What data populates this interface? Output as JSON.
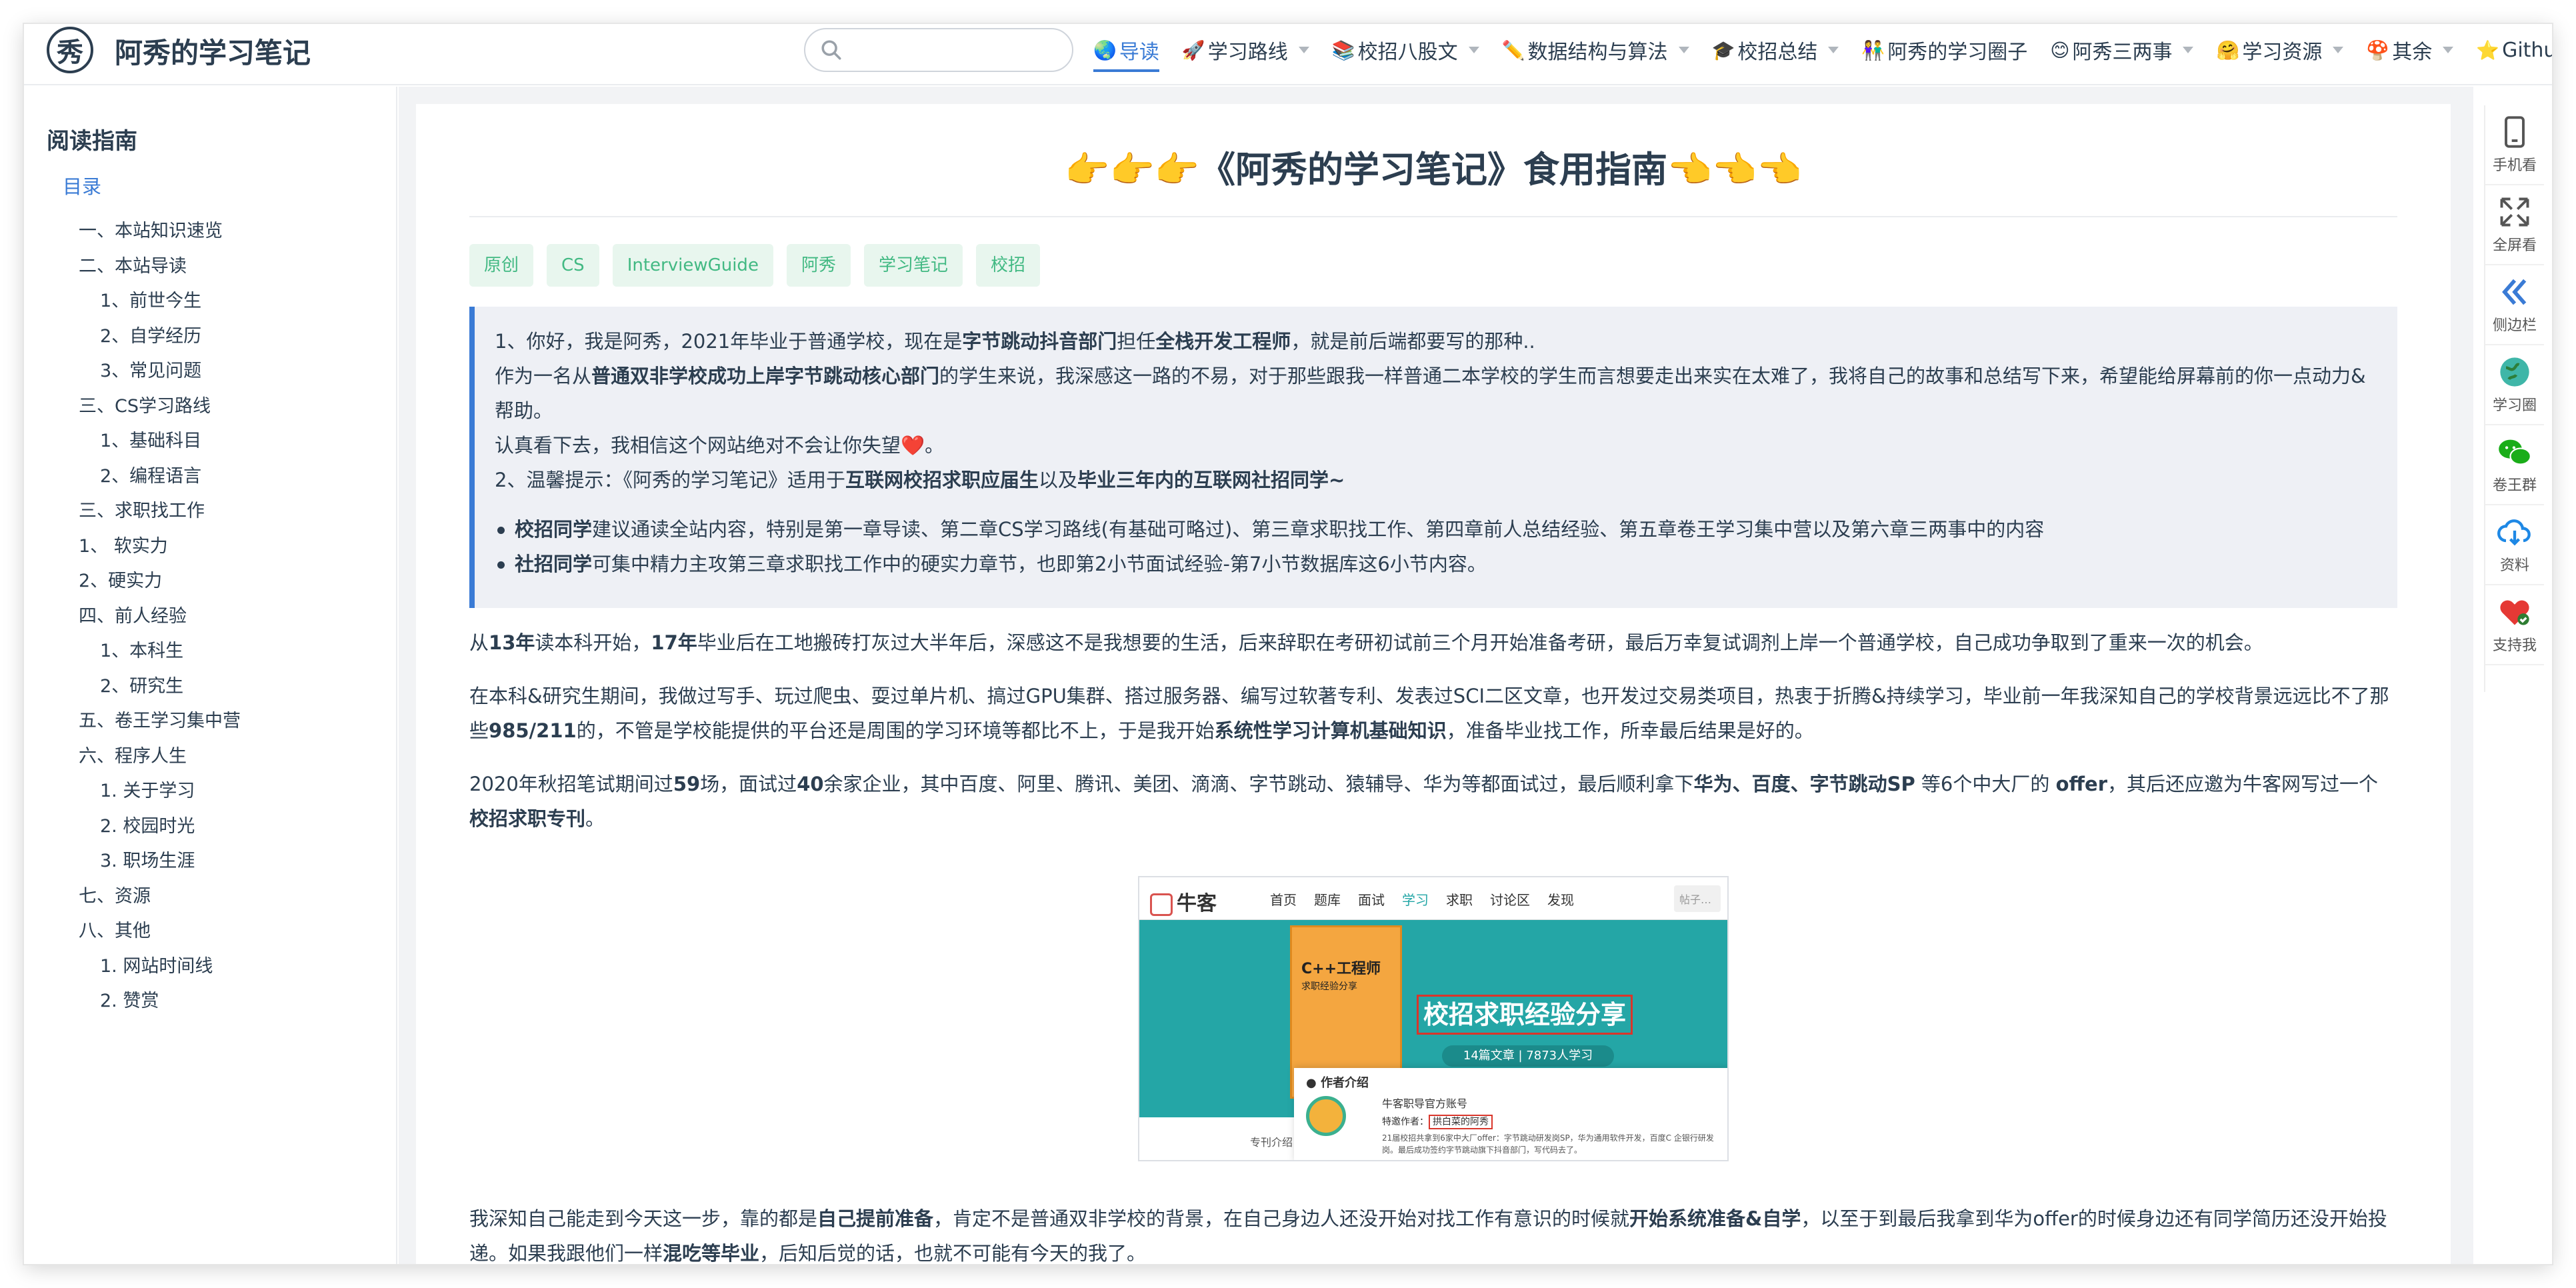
{
  "site": {
    "title": "阿秀的学习笔记",
    "logo_char": "秀"
  },
  "search": {
    "placeholder": "",
    "value": ""
  },
  "nav": [
    {
      "emoji": "🌏",
      "label": "导读",
      "active": true,
      "dropdown": false
    },
    {
      "emoji": "🚀",
      "label": "学习路线",
      "active": false,
      "dropdown": true
    },
    {
      "emoji": "📚",
      "label": "校招八股文",
      "active": false,
      "dropdown": true
    },
    {
      "emoji": "✏️",
      "label": "数据结构与算法",
      "active": false,
      "dropdown": true
    },
    {
      "emoji": "🎓",
      "label": "校招总结",
      "active": false,
      "dropdown": true
    },
    {
      "emoji": "👫",
      "label": "阿秀的学习圈子",
      "active": false,
      "dropdown": false
    },
    {
      "emoji": "😊",
      "label": "阿秀三两事",
      "active": false,
      "dropdown": true
    },
    {
      "emoji": "🤗",
      "label": "学习资源",
      "active": false,
      "dropdown": true
    },
    {
      "emoji": "🍄",
      "label": "其余",
      "active": false,
      "dropdown": true
    },
    {
      "emoji": "⭐",
      "label": "Github",
      "active": false,
      "dropdown": false,
      "external": true
    }
  ],
  "sidebar": {
    "heading": "阅读指南",
    "dir": "目录",
    "items": [
      {
        "label": "一、本站知识速览",
        "level": 1
      },
      {
        "label": "二、本站导读",
        "level": 1
      },
      {
        "label": "1、前世今生",
        "level": 2
      },
      {
        "label": "2、自学经历",
        "level": 2
      },
      {
        "label": "3、常见问题",
        "level": 2
      },
      {
        "label": "三、CS学习路线",
        "level": 1
      },
      {
        "label": "1、基础科目",
        "level": 2
      },
      {
        "label": "2、编程语言",
        "level": 2
      },
      {
        "label": "三、求职找工作",
        "level": 1
      },
      {
        "label": "1、 软实力",
        "level": 1
      },
      {
        "label": "2、硬实力",
        "level": 1
      },
      {
        "label": "四、前人经验",
        "level": 1
      },
      {
        "label": "1、本科生",
        "level": 2
      },
      {
        "label": "2、研究生",
        "level": 2
      },
      {
        "label": "五、卷王学习集中营",
        "level": 1
      },
      {
        "label": "六、程序人生",
        "level": 1
      },
      {
        "label": "1. 关于学习",
        "level": 2
      },
      {
        "label": "2. 校园时光",
        "level": 2
      },
      {
        "label": "3. 职场生涯",
        "level": 2
      },
      {
        "label": "七、资源",
        "level": 1
      },
      {
        "label": "八、其他",
        "level": 1
      },
      {
        "label": "1. 网站时间线",
        "level": 2
      },
      {
        "label": "2. 赞赏",
        "level": 2
      }
    ]
  },
  "article": {
    "title": "👉👉👉《阿秀的学习笔记》食用指南👈👈👈",
    "tags": [
      "原创",
      "CS",
      "InterviewGuide",
      "阿秀",
      "学习笔记",
      "校招"
    ],
    "tip": {
      "p1_a": "1、你好，我是阿秀，2021年毕业于普通学校，现在是",
      "p1_b": "字节跳动抖音部门",
      "p1_c": "担任",
      "p1_d": "全栈开发工程师",
      "p1_e": "，就是前后端都要写的那种..",
      "p2_a": "作为一名从",
      "p2_b": "普通双非学校成功上岸字节跳动核心部门",
      "p2_c": "的学生来说，我深感这一路的不易，对于那些跟我一样普通二本学校的学生而言想要走出来实在太难了，我将自己的故事和总结写下来，希望能给屏幕前的你一点动力&帮助。",
      "p3": "认真看下去，我相信这个网站绝对不会让你失望❤️。",
      "p4_a": "2、温馨提示：《阿秀的学习笔记》适用于",
      "p4_b": "互联网校招求职应届生",
      "p4_c": "以及",
      "p4_d": "毕业三年内的互联网社招同学~",
      "li1_b": "校招同学",
      "li1": "建议通读全站内容，特别是第一章导读、第二章CS学习路线(有基础可略过)、第三章求职找工作、第四章前人总结经验、第五章卷王学习集中营以及第六章三两事中的内容",
      "li2_b": "社招同学",
      "li2": "可集中精力主攻第三章求职找工作中的硬实力章节，也即第2小节面试经验-第7小节数据库这6小节内容。"
    },
    "para1_a": "从",
    "para1_b": "13年",
    "para1_c": "读本科开始，",
    "para1_d": "17年",
    "para1_e": "毕业后在工地搬砖打灰过大半年后，深感这不是我想要的生活，后来辞职在考研初试前三个月开始准备考研，最后万幸复试调剂上岸一个普通学校，自己成功争取到了重来一次的机会。",
    "para2_a": "在本科&研究生期间，我做过写手、玩过爬虫、耍过单片机、搞过GPU集群、搭过服务器、编写过软著专利、发表过SCI二区文章，也开发过交易类项目，热衷于折腾&持续学习，毕业前一年我深知自己的学校背景远远比不了那些",
    "para2_b": "985/211",
    "para2_c": "的，不管是学校能提供的平台还是周围的学习环境等都比不上，于是我开始",
    "para2_d": "系统性学习计算机基础知识",
    "para2_e": "，准备毕业找工作，所幸最后结果是好的。",
    "para3_a": "2020年秋招笔试期间过",
    "para3_b": "59",
    "para3_c": "场，面试过",
    "para3_d": "40",
    "para3_e": "余家企业，其中百度、阿里、腾讯、美团、滴滴、字节跳动、猿辅导、华为等都面试过，最后顺利拿下",
    "para3_f": "华为、百度、字节跳动SP",
    "para3_g": " 等6个中大厂的 ",
    "para3_h": "offer",
    "para3_i": "，其后还应邀为牛客网写过一个",
    "para3_j": "校招求职专刊",
    "para3_k": "。",
    "para4_a": "我深知自己能走到今天这一步，靠的都是",
    "para4_b": "自己提前准备",
    "para4_c": "，肯定不是普通双非学校的背景，在自己身边人还没开始对找工作有意识的时候就",
    "para4_d": "开始系统准备&自学",
    "para4_e": "，以至于到最后我拿到华为offer的时候身边还有同学简历还没开始投递。如果我跟他们一样",
    "para4_f": "混吃等毕业",
    "para4_g": "，后知后觉的话，也就不可能有今天的我了。"
  },
  "screenshot": {
    "logo": "牛客",
    "nav": [
      "首页",
      "题库",
      "面试",
      "学习",
      "求职",
      "讨论区",
      "发现"
    ],
    "active_nav": "学习",
    "search": "帖子…",
    "book_title": "C++工程师",
    "book_sub": "求职经验分享",
    "banner": "校招求职经验分享",
    "stats": "14篇文章  |  7873人学习",
    "card_head": "● 作者介绍",
    "card_name": "牛客职导官方账号",
    "card_role_label": "特邀作者：",
    "card_role": "拱白菜的阿秀",
    "card_desc": "21届校招共拿到6家中大厂offer：字节跳动研发岗SP，华为通用软件开发，百度C 企银行研发岗。最后成功签约字节跳动旗下抖音部门，写代码去了。",
    "bottom_text": "专刊介绍"
  },
  "right_toolbar": [
    {
      "label": "手机看",
      "icon": "phone-icon"
    },
    {
      "label": "全屏看",
      "icon": "fullscreen-icon"
    },
    {
      "label": "侧边栏",
      "icon": "sidebar-collapse-icon"
    },
    {
      "label": "学习圈",
      "icon": "globe-icon"
    },
    {
      "label": "卷王群",
      "icon": "wechat-icon"
    },
    {
      "label": "资料",
      "icon": "cloud-download-icon"
    },
    {
      "label": "支持我",
      "icon": "heart-icon"
    }
  ],
  "colors": {
    "accent": "#3a7bd5",
    "tag_green": "#42b983",
    "text": "#2c3e50"
  }
}
